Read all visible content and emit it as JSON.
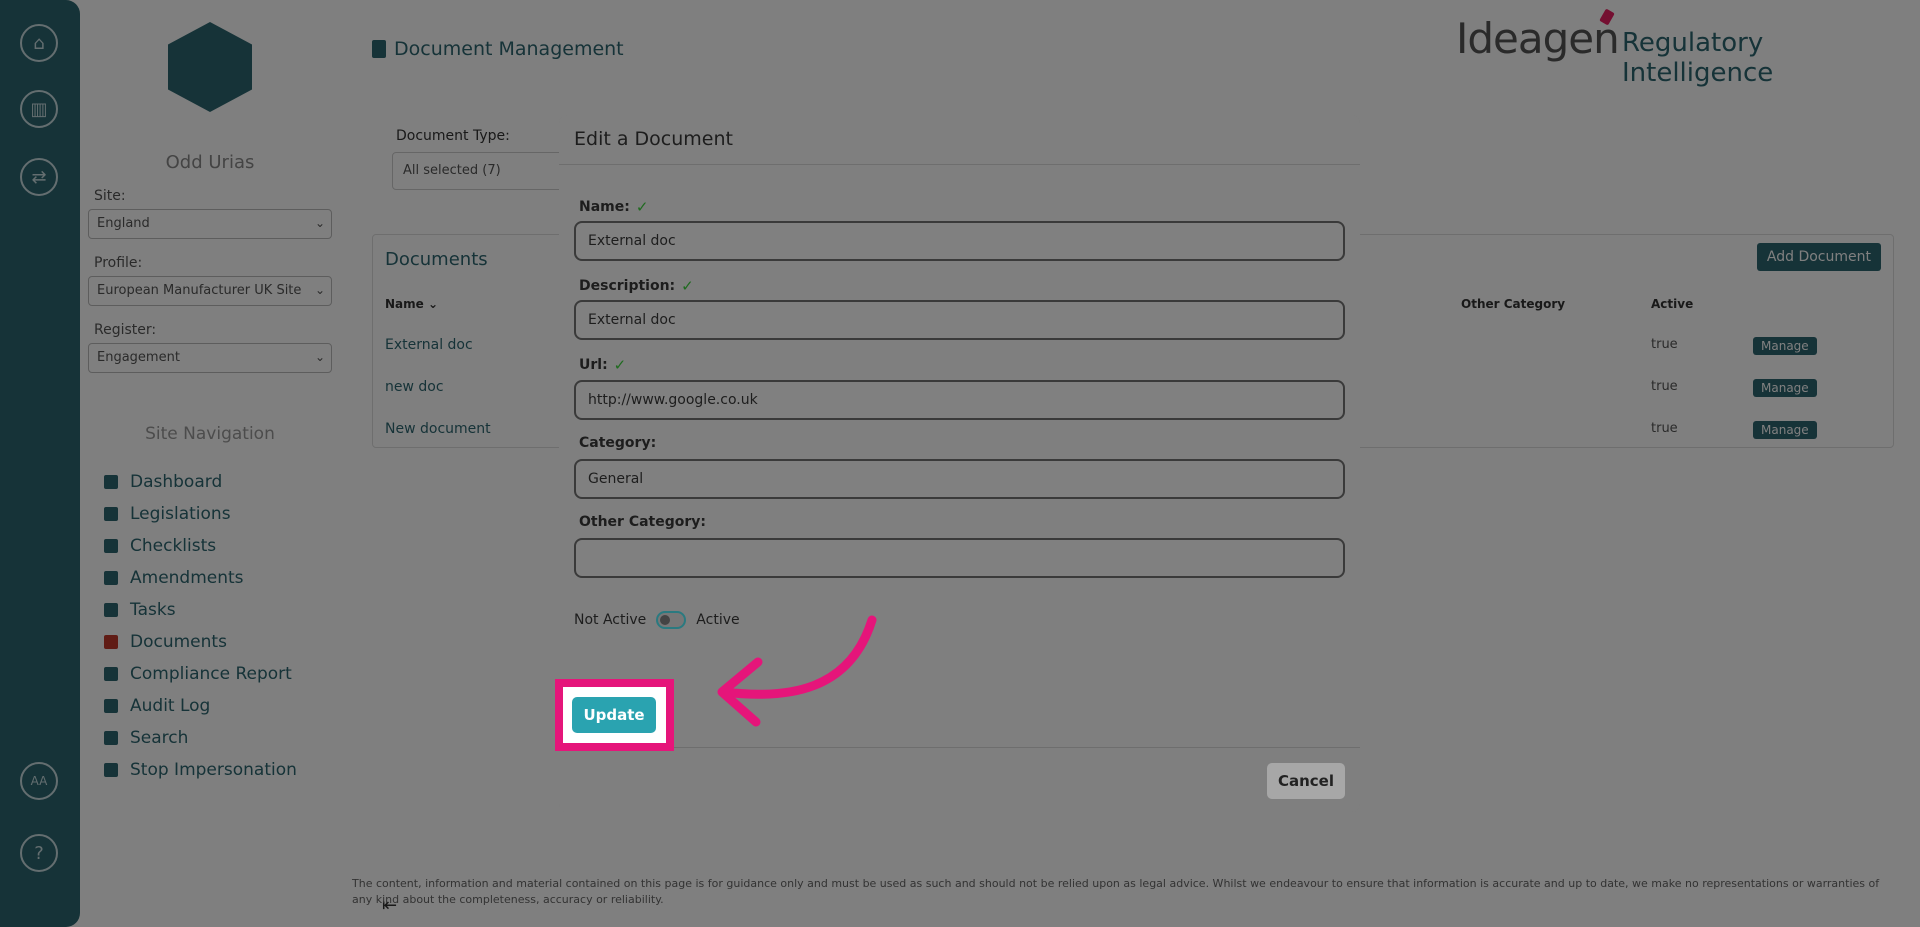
{
  "app": {
    "page_title": "Document Management",
    "brand": "Ideagen",
    "brand_sub": "Regulatory Intelligence"
  },
  "sidebar": {
    "user_name": "Odd Urias",
    "site_label": "Site:",
    "site_value": "England",
    "profile_label": "Profile:",
    "profile_value": "European Manufacturer UK Site",
    "register_label": "Register:",
    "register_value": "Engagement",
    "nav_title": "Site Navigation",
    "nav_items": [
      {
        "label": "Dashboard"
      },
      {
        "label": "Legislations"
      },
      {
        "label": "Checklists"
      },
      {
        "label": "Amendments"
      },
      {
        "label": "Tasks"
      },
      {
        "label": "Documents"
      },
      {
        "label": "Compliance Report"
      },
      {
        "label": "Audit Log"
      },
      {
        "label": "Search"
      },
      {
        "label": "Stop Impersonation"
      }
    ]
  },
  "rail": {
    "avatar_initials": "AA",
    "help": "?"
  },
  "filters": {
    "doc_type_label": "Document Type:",
    "doc_type_value": "All selected (7)"
  },
  "documents": {
    "title": "Documents",
    "add_label": "Add Document",
    "columns": [
      "Name ⌄",
      "Other Category",
      "Active"
    ],
    "rows": [
      {
        "name": "External doc",
        "active": "true",
        "action": "Manage"
      },
      {
        "name": "new doc",
        "active": "true",
        "action": "Manage"
      },
      {
        "name": "New document",
        "active": "true",
        "action": "Manage"
      }
    ]
  },
  "footer_text": "The content, information and material contained on this page is for guidance only and must be used as such and should not be relied upon as legal advice. Whilst we endeavour to ensure that information is accurate and up to date, we make no representations or warranties of any kind about the completeness, accuracy or reliability.",
  "modal": {
    "title": "Edit a Document",
    "fields": {
      "name": {
        "label": "Name:",
        "value": "External doc",
        "valid": true
      },
      "description": {
        "label": "Description:",
        "value": "External doc",
        "valid": true
      },
      "url": {
        "label": "Url:",
        "value": "http://www.google.co.uk",
        "valid": true
      },
      "category": {
        "label": "Category:",
        "value": "General"
      },
      "other_category": {
        "label": "Other Category:",
        "value": ""
      }
    },
    "toggle": {
      "off_label": "Not Active",
      "on_label": "Active"
    },
    "update_label": "Update",
    "cancel_label": "Cancel"
  },
  "colors": {
    "accent": "#2aa3b0",
    "brand_teal": "#2d6670",
    "highlight": "#e5157a",
    "check": "#1f6b1f"
  }
}
